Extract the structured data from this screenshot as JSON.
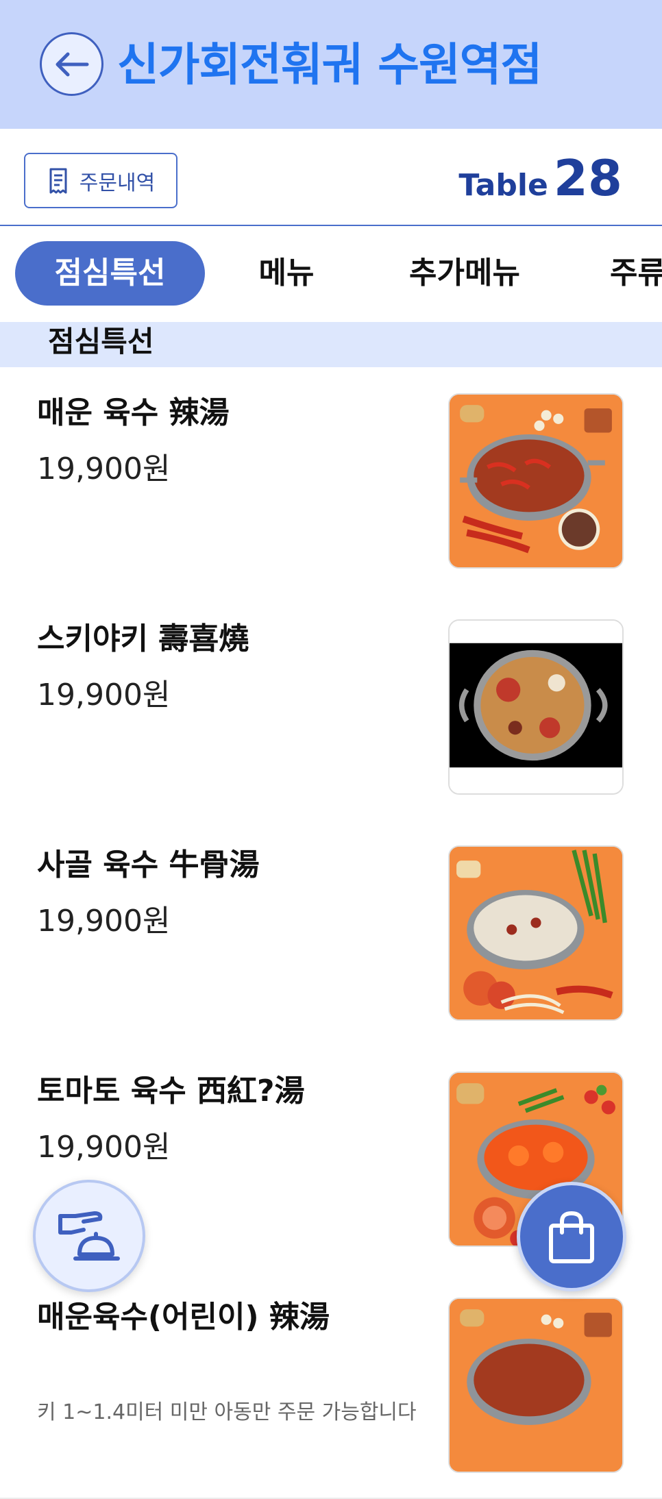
{
  "header": {
    "title": "신가회전훠궈 수원역점",
    "back_icon": "arrow-left-icon"
  },
  "subbar": {
    "order_history_label": "주문내역",
    "order_history_icon": "receipt-icon",
    "table_word": "Table",
    "table_number": "28"
  },
  "tabs": [
    {
      "label": "점심특선",
      "active": true
    },
    {
      "label": "메뉴",
      "active": false
    },
    {
      "label": "추가메뉴",
      "active": false
    },
    {
      "label": "주류",
      "active": false
    }
  ],
  "section": {
    "title": "점심특선"
  },
  "menu_items": [
    {
      "name": "매운 육수 辣湯",
      "price": "19,900원",
      "description": ""
    },
    {
      "name": "스키야키 壽喜燒",
      "price": "19,900원",
      "description": ""
    },
    {
      "name": "사골 육수 牛骨湯",
      "price": "19,900원",
      "description": ""
    },
    {
      "name": "토마토 육수 西紅?湯",
      "price": "19,900원",
      "description": ""
    },
    {
      "name": "매운육수(어린이) 辣湯",
      "price": "",
      "description": "키 1~1.4미터 미만 아동만 주문 가능합니다"
    }
  ],
  "fabs": {
    "staff_call_icon": "call-staff-bell-icon",
    "cart_icon": "shopping-bag-icon"
  },
  "colors": {
    "header_bg": "#c6d5fb",
    "title": "#1f74f0",
    "accent": "#4a6ecb",
    "section_bg": "#dde7fd"
  }
}
